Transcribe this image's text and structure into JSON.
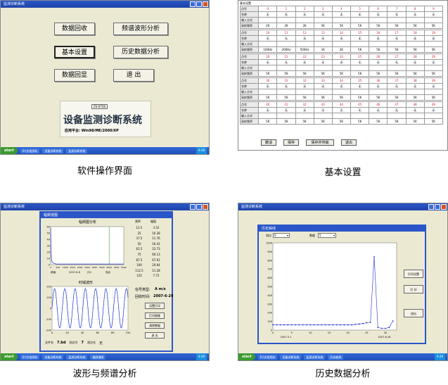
{
  "captions": {
    "p1": "软件操作界面",
    "p2": "基本设置",
    "p3": "波形与频谱分析",
    "p4": "历史数据分析"
  },
  "panel1": {
    "title": "监测诊断系统",
    "buttons": {
      "data_recovery": "数据回收",
      "spectrum_analysis": "频谱波形分析",
      "basic_settings": "基本设置",
      "history_analysis": "历史数据分析",
      "data_display": "数据回显",
      "exit": "退 出"
    },
    "splash": {
      "model": "ZS-6758",
      "name": "设备监测诊断系统",
      "platform": "应用平台: Win98/ME/2000/XP"
    },
    "taskbar": {
      "start": "start",
      "items": [
        "D:\\文档资料",
        "设备诊断系统",
        "监测诊断系统"
      ],
      "clock": "9:38"
    }
  },
  "panel2": {
    "title": "基本设置",
    "row_labels": {
      "no": "点号",
      "name": "名称",
      "input": "输入方式",
      "freq": "采样频率"
    },
    "groups": [
      {
        "nums": [
          "0",
          "1",
          "2",
          "3",
          "4",
          "5",
          "6",
          "7",
          "8",
          "9"
        ],
        "names": [
          "无",
          "无",
          "无",
          "无",
          "无",
          "无",
          "无",
          "无",
          "无",
          "无"
        ],
        "freqs": [
          "2K",
          "2K",
          "2K",
          "5K",
          "5K",
          "5K",
          "5K",
          "5K",
          "5K",
          "5K"
        ]
      },
      {
        "nums": [
          "10",
          "11",
          "12",
          "13",
          "14",
          "15",
          "16",
          "17",
          "18",
          "19"
        ],
        "names": [
          "无",
          "无",
          "无",
          "无",
          "无",
          "无",
          "无",
          "无",
          "无",
          "无"
        ],
        "freqs": [
          "100Hz",
          "200Hz",
          "500Hz",
          "1K",
          "2K",
          "5K",
          "5K",
          "5K",
          "5K",
          "5K"
        ]
      },
      {
        "nums": [
          "20",
          "21",
          "22",
          "23",
          "24",
          "25",
          "26",
          "27",
          "28",
          "29"
        ],
        "names": [
          "无",
          "无",
          "无",
          "无",
          "无",
          "无",
          "无",
          "无",
          "无",
          "无"
        ],
        "freqs": [
          "5K",
          "5K",
          "5K",
          "5K",
          "5K",
          "5K",
          "5K",
          "5K",
          "5K",
          "5K"
        ]
      },
      {
        "nums": [
          "30",
          "31",
          "32",
          "33",
          "34",
          "35",
          "36",
          "37",
          "38",
          "39"
        ],
        "names": [
          "无",
          "无",
          "无",
          "无",
          "无",
          "无",
          "无",
          "无",
          "无",
          "无"
        ],
        "freqs": [
          "5K",
          "5K",
          "5K",
          "5K",
          "5K",
          "5K",
          "5K",
          "5K",
          "5K",
          "5K"
        ]
      },
      {
        "nums": [
          "40",
          "41",
          "42",
          "43",
          "44",
          "45",
          "46",
          "47",
          "48",
          "49"
        ],
        "names": [
          "无",
          "无",
          "无",
          "无",
          "无",
          "无",
          "无",
          "无",
          "无",
          "无"
        ],
        "freqs": [
          "5K",
          "5K",
          "5K",
          "5K",
          "5K",
          "5K",
          "5K",
          "5K",
          "5K",
          "5K"
        ]
      }
    ],
    "buttons": {
      "cancel": "撤消",
      "save": "保存",
      "save_download": "保存并传输",
      "exit": "退出"
    }
  },
  "panel3": {
    "outer_title": "监测诊断系统",
    "window_title": "幅频谱图",
    "spectrum_title": "幅频图分析",
    "spectrum_xticks": [
      "0",
      "500",
      "1000",
      "1500",
      "2000",
      "2500",
      "3000",
      "3500",
      "4000",
      "4500",
      "5000"
    ],
    "spectrum_yticks": [
      "60",
      "50",
      "40",
      "30",
      "20",
      "10",
      "0"
    ],
    "freq_header": "频率",
    "amp_header": "幅值",
    "freqs": [
      "12.5",
      "25",
      "37.5",
      "50",
      "62.5",
      "75",
      "87.5",
      "100",
      "112.5",
      "125"
    ],
    "amps": [
      "3.52",
      "16.38",
      "11.76",
      "16.41",
      "22.73",
      "60.13",
      "67.61",
      "20.64",
      "11.28",
      "7.72"
    ],
    "spectrum_info": [
      "频谱:",
      "2007-6-8",
      "口0",
      "测点"
    ],
    "time_title": "时域波形",
    "time_yticks": [
      "200",
      "100",
      "0",
      "-100",
      "-200"
    ],
    "time_xticks": [
      "0",
      "20",
      "40",
      "60",
      "80",
      "100"
    ],
    "time_info": [
      "文件名",
      "7.bd",
      "测点号",
      "7",
      "测点名",
      "无"
    ],
    "signal_type_label": "信号类型:",
    "signal_type": "A m/s",
    "collect_time_label": "回收时间:",
    "collect_time": "2007-6-29",
    "buttons": [
      "设置打印",
      "打印图像",
      "清除数据",
      "退 出"
    ],
    "taskbar": {
      "start": "start",
      "items": [
        "D:\\文档资料",
        "设备诊断系统",
        "监测诊断系统",
        "幅频谱图"
      ],
      "clock": "9:39"
    }
  },
  "panel4": {
    "outer_title": "监测诊断系统",
    "window_title": "历史曲线",
    "select1_label": "测点",
    "select1_value": "0",
    "select2_label": "数据",
    "select2_value": "5",
    "yticks": [
      "1000",
      "900",
      "800",
      "700",
      "600",
      "500",
      "400",
      "300",
      "200",
      "100",
      "0"
    ],
    "xticks": [
      "0",
      "5",
      "10",
      "15",
      "20",
      "25",
      "30"
    ],
    "date_start": "2007-5-1",
    "date_end": "2007-6-28",
    "buttons": [
      "打印设置",
      "打 印",
      "退出"
    ],
    "taskbar": {
      "start": "start",
      "items": [
        "D:\\文档资料",
        "设备诊断系统",
        "监测诊断系统",
        "历史曲线"
      ],
      "clock": "9:39"
    }
  },
  "chart_data": [
    {
      "type": "line",
      "title": "幅频图分析",
      "xlim": [
        0,
        5000
      ],
      "ylim": [
        0,
        60
      ],
      "x": [
        0,
        30,
        60,
        100,
        200,
        400,
        700,
        1000,
        1500,
        2000,
        2500,
        3000,
        3500,
        4000,
        4500,
        5000
      ],
      "values": [
        58,
        20,
        8,
        4,
        2,
        1,
        1,
        1,
        1,
        1,
        1,
        1,
        1,
        1,
        1,
        1
      ],
      "marker_x": 4000
    },
    {
      "type": "line",
      "title": "时域波形",
      "xlim": [
        0,
        100
      ],
      "ylim": [
        -200,
        200
      ],
      "period": 13.5,
      "amplitude": 180
    },
    {
      "type": "line",
      "title": "历史曲线",
      "xlim": [
        0,
        33
      ],
      "ylim": [
        0,
        1000
      ],
      "x": [
        0,
        1,
        2,
        3,
        4,
        5,
        6,
        7,
        8,
        9,
        10,
        11,
        12,
        13,
        14,
        15,
        16,
        17,
        18,
        19,
        20,
        21,
        22,
        23,
        24,
        25,
        26,
        27,
        28,
        29,
        30,
        31,
        32
      ],
      "values": [
        60,
        60,
        60,
        60,
        60,
        60,
        60,
        60,
        60,
        60,
        60,
        60,
        60,
        60,
        60,
        60,
        60,
        60,
        60,
        60,
        60,
        60,
        65,
        70,
        75,
        85,
        90,
        840,
        30,
        20,
        20,
        30,
        105
      ]
    }
  ]
}
